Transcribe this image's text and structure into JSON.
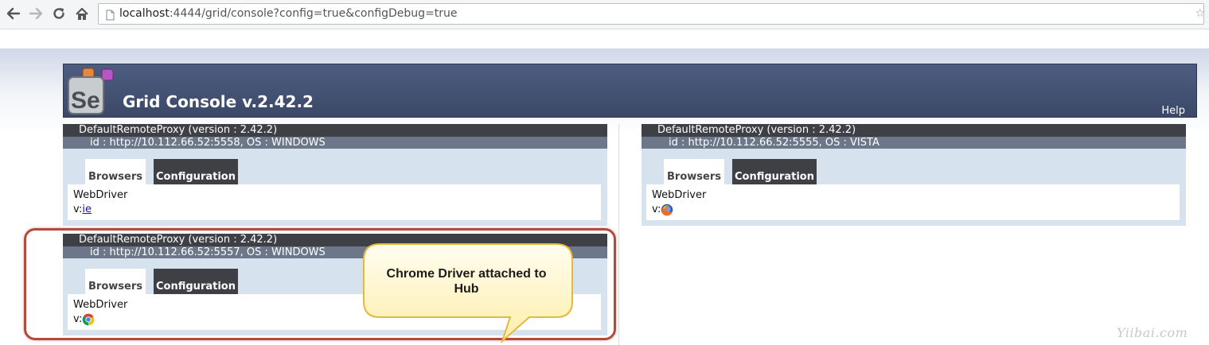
{
  "browser": {
    "url_host": "localhost",
    "url_rest": ":4444/grid/console?config=true&configDebug=true",
    "back_icon": "back-arrow-icon",
    "forward_icon": "forward-arrow-icon",
    "reload_icon": "reload-icon",
    "home_icon": "home-icon"
  },
  "header": {
    "title": "Grid Console v.2.42.2",
    "help_label": "Help",
    "logo_text": "Se"
  },
  "proxies": [
    {
      "name": "DefaultRemoteProxy (version : 2.42.2)",
      "id": "id : http://10.112.66.52:5558, OS : WINDOWS",
      "tabs": [
        "Browsers",
        "Configuration"
      ],
      "driver": "WebDriver",
      "version_prefix": "v:",
      "browser": "ie",
      "browser_icon": "ie-link"
    },
    {
      "name": "DefaultRemoteProxy (version : 2.42.2)",
      "id": "id : http://10.112.66.52:5555, OS : VISTA",
      "tabs": [
        "Browsers",
        "Configuration"
      ],
      "driver": "WebDriver",
      "version_prefix": "v:",
      "browser_icon": "firefox-icon"
    },
    {
      "name": "DefaultRemoteProxy (version : 2.42.2)",
      "id": "id : http://10.112.66.52:5557, OS : WINDOWS",
      "tabs": [
        "Browsers",
        "Configuration"
      ],
      "driver": "WebDriver",
      "version_prefix": "v:",
      "browser_icon": "chrome-icon"
    }
  ],
  "annotation": {
    "callout_text": "Chrome Driver attached to Hub"
  },
  "watermark": "Yiibai.com",
  "colors": {
    "header_bg": "#46557a",
    "proxy_name_bg": "#3f3f46",
    "proxy_id_bg": "#6d778a",
    "panel_bg": "#d7e2ef",
    "highlight_border": "#b54a3c",
    "callout_fill": "#fff6cc"
  }
}
